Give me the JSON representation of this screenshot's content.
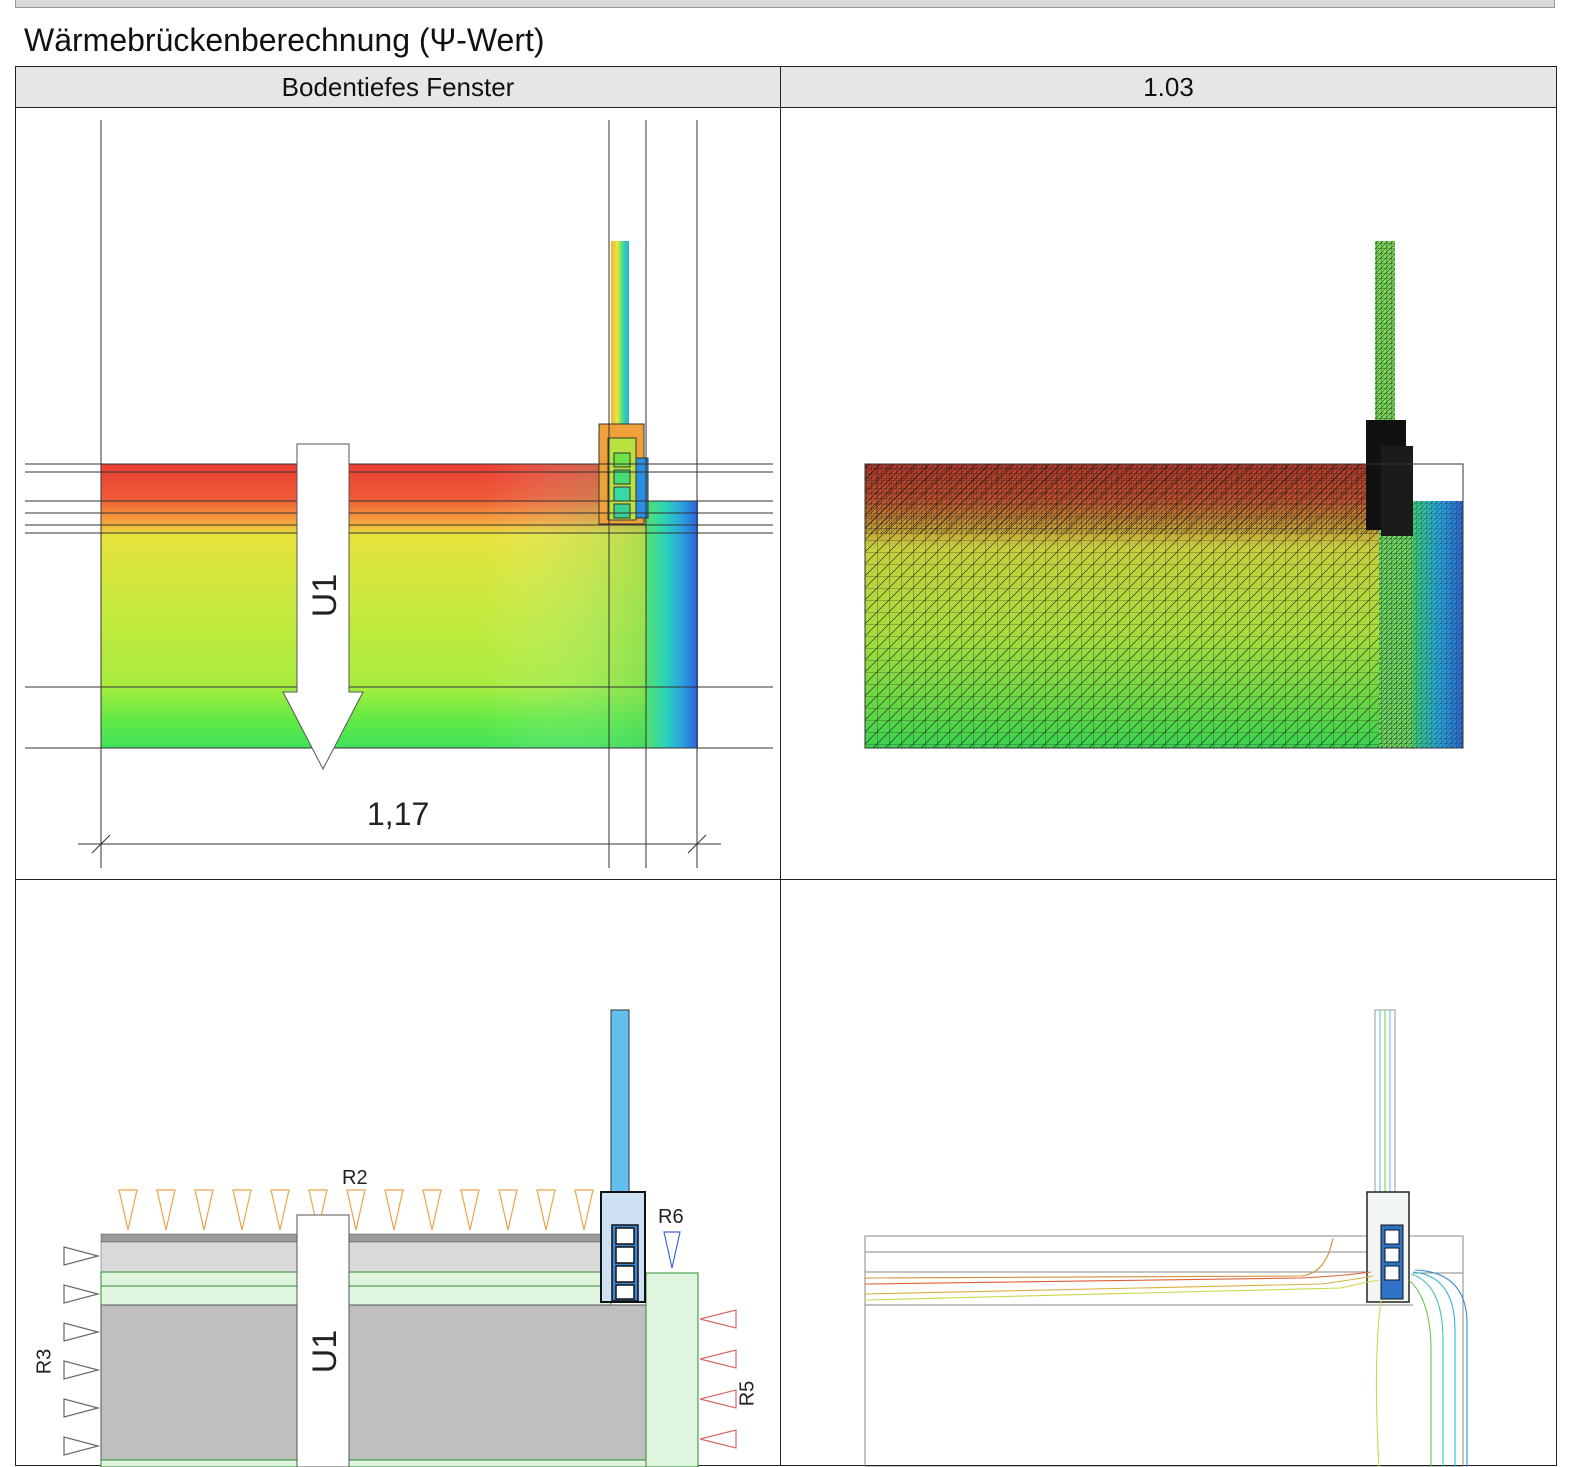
{
  "page": {
    "title": "Wärmebrückenberechnung (Ψ-Wert)"
  },
  "table": {
    "header_left": "Bodentiefes Fenster",
    "header_right": "1.03"
  },
  "panels": {
    "temperature": {
      "arrow_label": "U1",
      "dimension_label": "1,17"
    },
    "boundary": {
      "arrow_label": "U1",
      "labels": {
        "r2": "R2",
        "r3": "R3",
        "r5": "R5",
        "r6": "R6"
      }
    }
  }
}
